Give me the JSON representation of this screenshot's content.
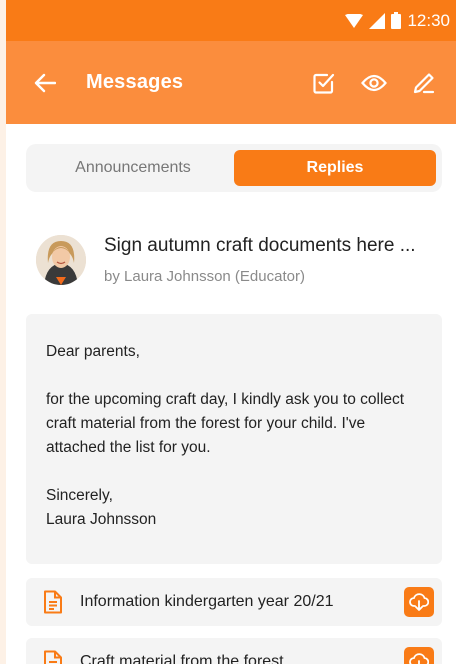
{
  "status_bar": {
    "time": "12:30"
  },
  "app_bar": {
    "title": "Messages"
  },
  "tabs": [
    {
      "label": "Announcements",
      "active": false
    },
    {
      "label": "Replies",
      "active": true
    }
  ],
  "message": {
    "title": "Sign autumn craft documents here ...",
    "author": "by Laura Johnsson (Educator)",
    "body": {
      "greeting": "Dear parents,",
      "text": "for the upcoming craft day, I kindly ask you to collect craft material from the forest for your child. I've attached the list for you.",
      "closing": "Sincerely,",
      "signature": "Laura Johnsson"
    }
  },
  "attachments": [
    {
      "name": "Information kindergarten year 20/21"
    },
    {
      "name": "Craft material from the forest"
    }
  ],
  "colors": {
    "primary": "#f97b16",
    "appbar": "#fb8d3d",
    "surface": "#f4f4f4"
  }
}
